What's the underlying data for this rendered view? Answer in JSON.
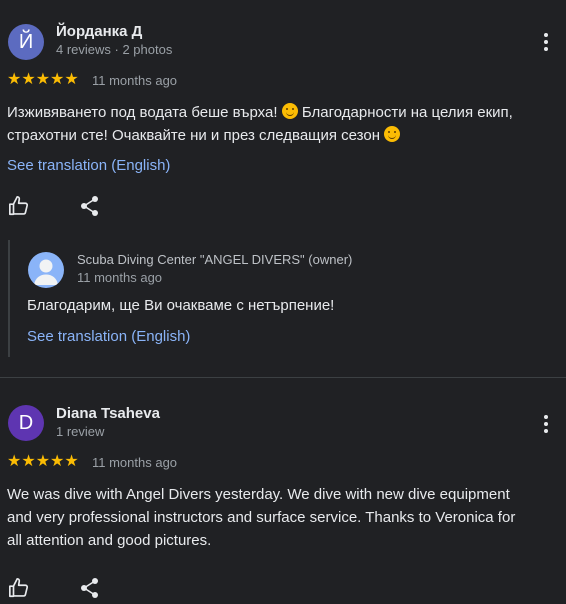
{
  "reviews": [
    {
      "avatar_letter": "Й",
      "avatar_color": "#5c6bc0",
      "name": "Йорданка Д",
      "meta": "4 reviews · 2 photos",
      "stars": "★★★★★",
      "time": "11 months ago",
      "text_part1": "Изживяването под водата беше върха!",
      "text_part2": "Благодарности на целия екип,",
      "text_line2": "страхотни сте! Очаквайте ни и през следващия сезон",
      "see_translation": "See translation (English)",
      "reply": {
        "author": "Scuba Diving Center \"ANGEL DIVERS\" (owner)",
        "time": "11 months ago",
        "text": "Благодарим, ще Ви очакваме с нетърпение!",
        "see_translation": "See translation (English)"
      }
    },
    {
      "avatar_letter": "D",
      "avatar_color": "#5e35b1",
      "name": "Diana Tsaheva",
      "meta": "1 review",
      "stars": "★★★★★",
      "time": "11 months ago",
      "text_lines": [
        "We was dive with Angel Divers yesterday. We dive with new dive equipment",
        "and very professional instructors and surface service. Thanks to Veronica for",
        "all attention and good pictures."
      ]
    }
  ],
  "icons": {
    "like": "thumb-up-icon",
    "share": "share-icon",
    "more": "more-vert-icon",
    "owner_avatar": "person-icon"
  },
  "colors": {
    "background": "#202124",
    "star": "#fbbc04",
    "link": "#8ab4f8",
    "owner_avatar_bg": "#8ab4f8"
  }
}
